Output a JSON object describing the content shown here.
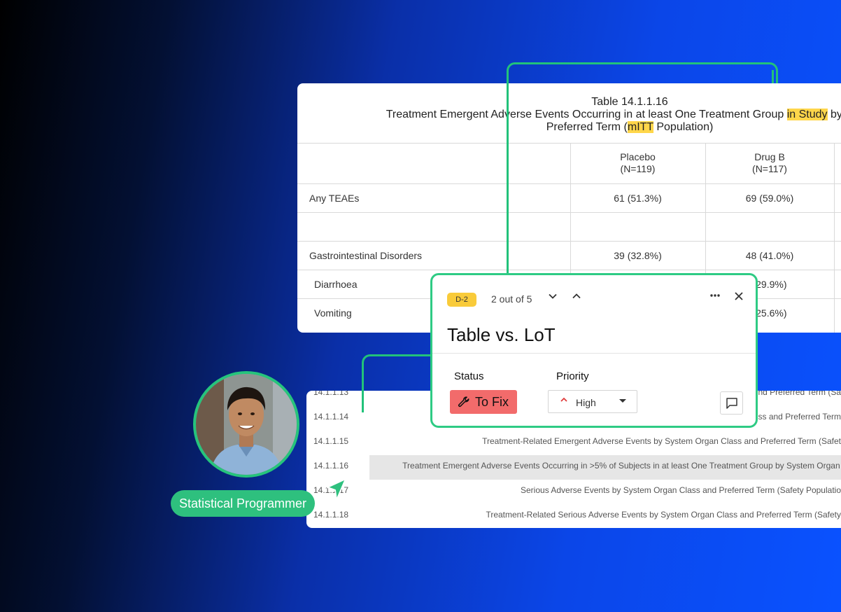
{
  "table_card": {
    "title_line1": "Table 14.1.1.16",
    "title_line2_pre": "Treatment Emergent Adverse Events Occurring in at least One Treatment Group ",
    "title_line2_hl": "in Study",
    "title_line2_post": " by Syste",
    "title_line3_pre": "Preferred Term (",
    "title_line3_hl": "mITT",
    "title_line3_post": " Population)",
    "columns": [
      {
        "name": "Placebo",
        "n": "(N=119)"
      },
      {
        "name": "Drug B",
        "n": "(N=117)"
      }
    ],
    "rows": [
      {
        "label": "Any TEAEs",
        "placebo": "61 (51.3%)",
        "drug_b": "69 (59.0%)"
      },
      {
        "label": "",
        "placebo": "",
        "drug_b": ""
      },
      {
        "label": "Gastrointestinal Disorders",
        "placebo": "39 (32.8%)",
        "drug_b": "48 (41.0%)"
      },
      {
        "label": "Diarrhoea",
        "placebo": "",
        "drug_b": "(29.9%)"
      },
      {
        "label": "Vomiting",
        "placebo": "",
        "drug_b": "(25.6%)"
      }
    ]
  },
  "list_card": {
    "rows": [
      {
        "id": "14.1.1.13",
        "text": "nd Preferred Term (Sa"
      },
      {
        "id": "14.1.1.14",
        "text": "ss and Preferred Term"
      },
      {
        "id": "14.1.1.15",
        "text": "Treatment-Related Emergent Adverse Events by System Organ Class and Preferred Term (Safet"
      },
      {
        "id": "14.1.1.16",
        "text": "Treatment Emergent Adverse Events Occurring in >5% of Subjects in at least One Treatment Group by System Organ Class"
      },
      {
        "id": "14.1.1.17",
        "text": "Serious Adverse Events by System Organ Class and Preferred Term (Safety Populatio"
      },
      {
        "id": "14.1.1.18",
        "text": "Treatment-Related Serious Adverse Events by System Organ Class and Preferred Term (Safety"
      }
    ]
  },
  "popup": {
    "badge": "D-2",
    "counter": "2 out of 5",
    "title": "Table vs. LoT",
    "status_label": "Status",
    "status_value": "To Fix",
    "priority_label": "Priority",
    "priority_value": "High",
    "icons": [
      "chevron-down-icon",
      "chevron-up-icon",
      "more-icon",
      "close-icon",
      "wrench-icon",
      "comment-icon"
    ]
  },
  "user": {
    "role": "Statistical Programmer"
  },
  "colors": {
    "accent_green": "#2ecb84",
    "highlight": "#ffd64a",
    "status_red": "#f26b6b",
    "badge_yellow": "#f9cb3a"
  }
}
